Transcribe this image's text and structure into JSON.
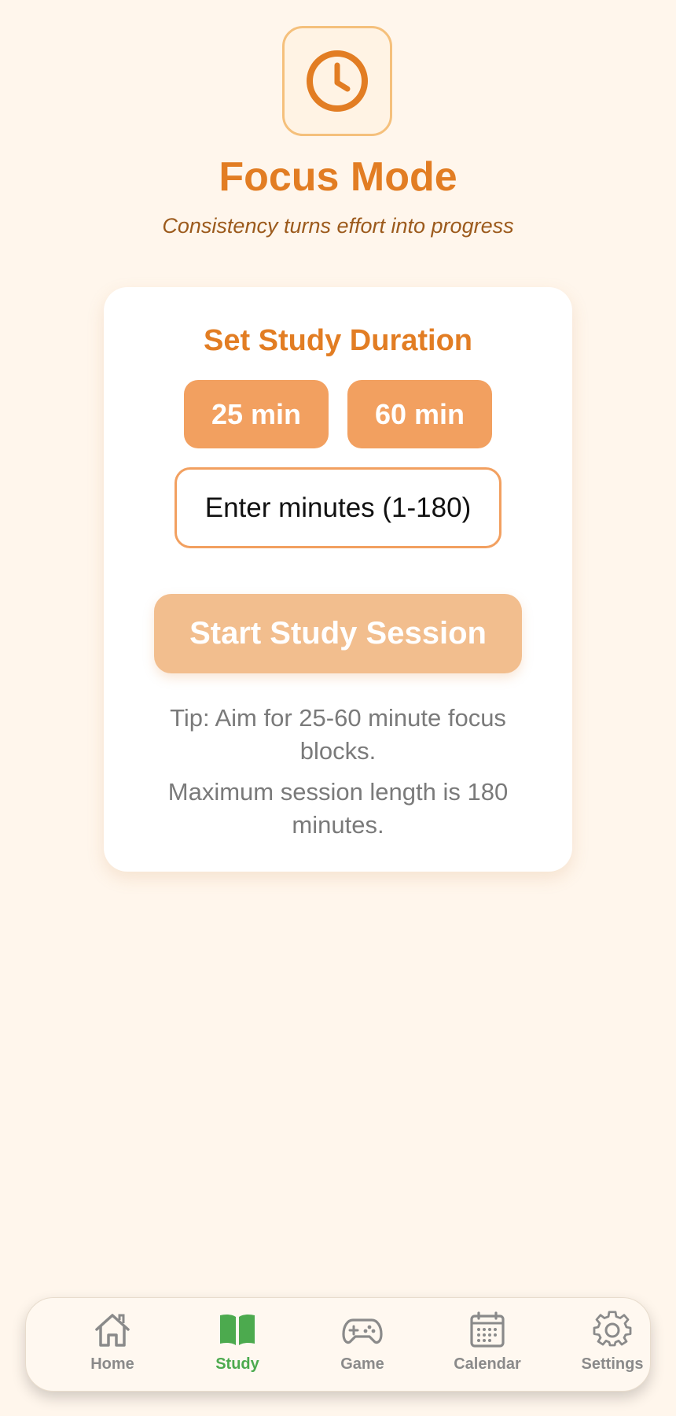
{
  "header": {
    "logo_icon": "clock-icon",
    "title": "Focus Mode",
    "subtitle": "Consistency turns effort into progress"
  },
  "card": {
    "title": "Set Study Duration",
    "presets": [
      "25 min",
      "60 min"
    ],
    "minutes_input": {
      "placeholder": "Enter minutes (1-180)",
      "value": ""
    },
    "start_label": "Start Study Session",
    "tips": [
      "Tip: Aim for 25-60 minute focus blocks.",
      "Maximum session length is 180 minutes."
    ]
  },
  "nav": {
    "active": "Study",
    "items": [
      {
        "label": "Home",
        "icon": "home-icon"
      },
      {
        "label": "Study",
        "icon": "book-icon"
      },
      {
        "label": "Game",
        "icon": "gamepad-icon"
      },
      {
        "label": "Calendar",
        "icon": "calendar-icon"
      },
      {
        "label": "Settings",
        "icon": "gear-icon"
      }
    ]
  },
  "colors": {
    "accent": "#e27d23",
    "button": "#f2a060",
    "button_disabled": "#f2be8e",
    "active_nav": "#4caa4e",
    "background": "#fff6ec"
  }
}
